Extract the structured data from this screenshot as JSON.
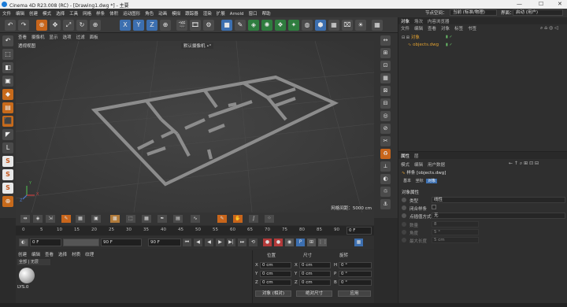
{
  "window": {
    "title": "Cinema 4D R23.008 (RC) - [Drawing1.dwg *] - 主要",
    "min": "—",
    "max": "☐",
    "close": "✕"
  },
  "menubar": {
    "items": [
      "文件",
      "编辑",
      "创建",
      "模式",
      "选择",
      "工具",
      "网格",
      "样条",
      "体积",
      "运动图形",
      "角色",
      "动画",
      "模拟",
      "跟踪器",
      "渲染",
      "扩展",
      "Arnold",
      "窗口",
      "帮助"
    ],
    "node_space_label": "节点空间：",
    "node_space_value": "当前 (标准/物理)",
    "layout_label": "界面：",
    "layout_value": "启动 (用户)"
  },
  "toolbar": {
    "undo": "↶",
    "redo": "↷",
    "move": "✥",
    "scale": "⤢",
    "rotate": "↻",
    "x": "X",
    "y": "Y",
    "z": "Z",
    "coord": "⊕",
    "render1": "🎬",
    "render2": "🎞",
    "render3": "⚙",
    "cube": "■",
    "pen": "✎",
    "subdiv": "◈",
    "array": "✺",
    "gen": "❖",
    "deformer": "✦",
    "field": "◍",
    "scene": "⬢",
    "camera": "⌧",
    "light": "☀",
    "floor": "▦"
  },
  "left_tools": [
    "↶",
    "⬚",
    "◧",
    "▣",
    "◆",
    "▤",
    "⬛",
    "◤",
    "L",
    "S",
    "S",
    "S",
    "⊕"
  ],
  "viewport": {
    "menu": [
      "查看",
      "摄像机",
      "显示",
      "选项",
      "过滤",
      "面板"
    ],
    "view_name": "透视视图",
    "camera_name": "默认摄像机 •°",
    "grid_spacing": "网格间距：5000 cm",
    "axis_y": "Y",
    "axis_x": "X",
    "axis_z": "Z"
  },
  "right_tools": [
    "↔",
    "⊞",
    "⊡",
    "▦",
    "⊠",
    "⊟",
    "◎",
    "⊘",
    "✂",
    "⊗",
    "♻",
    "⟂",
    "◐",
    "♲",
    "⚓"
  ],
  "timeline": {
    "ticks": [
      "0",
      "5",
      "10",
      "15",
      "20",
      "25",
      "30",
      "35",
      "40",
      "45",
      "50",
      "55",
      "60",
      "65",
      "70",
      "75",
      "80",
      "85",
      "90"
    ],
    "current_frame": "0 F",
    "start_frame": "0 F",
    "min_frame": "0 F",
    "end_frame": "90 F",
    "max_frame": "90 F",
    "buttons": [
      "⏮",
      "◀",
      "▶",
      "▶",
      "▶|",
      "⏭",
      "⟲"
    ],
    "key_buttons": [
      "●",
      "●",
      "◉",
      "P",
      "⊞",
      "⋮⋮",
      "▦"
    ]
  },
  "materials": {
    "menu": [
      "创建",
      "编辑",
      "查看",
      "选择",
      "材质",
      "纹理"
    ],
    "item_name": "LYS.0"
  },
  "coordinates": {
    "headers": [
      "位置",
      "尺寸",
      "旋转"
    ],
    "rows": [
      {
        "axis": "X",
        "pos": "0 cm",
        "saxis": "X",
        "size": "0 cm",
        "raxis": "H",
        "rot": "0 °"
      },
      {
        "axis": "Y",
        "pos": "0 cm",
        "saxis": "Y",
        "size": "0 cm",
        "raxis": "P",
        "rot": "0 °"
      },
      {
        "axis": "Z",
        "pos": "0 cm",
        "saxis": "Z",
        "size": "0 cm",
        "raxis": "B",
        "rot": "0 °"
      }
    ],
    "mode": "对象 (相对)",
    "size_mode": "绝对尺寸",
    "apply": "应用"
  },
  "objects": {
    "tabs": [
      "对象",
      "场次",
      "内容浏览器"
    ],
    "menu": [
      "文件",
      "编辑",
      "查看",
      "对象",
      "标签",
      "书签"
    ],
    "items": [
      {
        "name": "对象",
        "color": "#e0a030"
      },
      {
        "name": "objects.dwg",
        "color": "#e0a030"
      }
    ]
  },
  "attributes": {
    "tabs": [
      "属性",
      "层"
    ],
    "menu": [
      "模式",
      "编辑",
      "用户数据"
    ],
    "object_title": "样条 [objects.dwg]",
    "subtabs": [
      "基本",
      "坐标",
      "对象"
    ],
    "section": "对象属性",
    "rows": [
      {
        "label": "类型",
        "value": "线性"
      },
      {
        "label": "闭合样条",
        "value": ""
      },
      {
        "label": "点插值方式",
        "value": "无"
      },
      {
        "label": "数量",
        "value": "8"
      },
      {
        "label": "角度",
        "value": "5 °"
      },
      {
        "label": "最大长度",
        "value": "5 cm"
      }
    ]
  },
  "colors": {
    "accent": "#3c6fb0",
    "orange": "#c8651b",
    "keyframe_red": "#b23a3a"
  }
}
